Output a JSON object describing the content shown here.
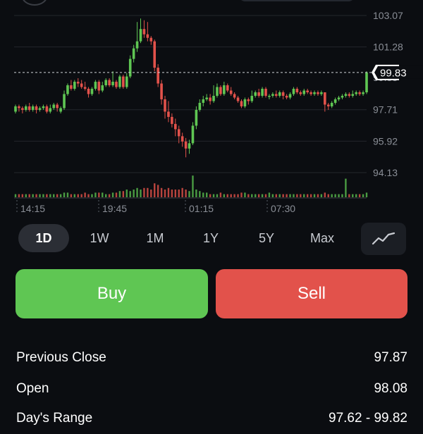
{
  "chart_data": {
    "type": "candlestick",
    "y_ticks": [
      "103.07",
      "101.28",
      "99.83",
      "97.71",
      "95.92",
      "94.13"
    ],
    "current_price": "99.83",
    "x_ticks": [
      "14:15",
      "19:45",
      "01:15",
      "07:30"
    ],
    "ylim": [
      93.0,
      104.0
    ],
    "colors": {
      "up": "#5fc653",
      "down": "#e2524b",
      "volume_up": "#4a9b42",
      "volume_down": "#b8443e"
    },
    "candles": [
      [
        97.6,
        97.9,
        97.5,
        98.0
      ],
      [
        97.9,
        97.8,
        97.6,
        98.0
      ],
      [
        97.8,
        97.7,
        97.5,
        97.9
      ],
      [
        97.7,
        97.9,
        97.6,
        98.0
      ],
      [
        97.9,
        97.7,
        97.6,
        98.1
      ],
      [
        97.7,
        97.9,
        97.6,
        98.0
      ],
      [
        97.9,
        97.7,
        97.5,
        98.0
      ],
      [
        97.7,
        97.8,
        97.6,
        97.9
      ],
      [
        97.8,
        97.9,
        97.7,
        98.0
      ],
      [
        97.9,
        97.6,
        97.5,
        98.0
      ],
      [
        97.6,
        97.8,
        97.5,
        98.0
      ],
      [
        97.8,
        98.0,
        97.7,
        98.1
      ],
      [
        98.0,
        97.8,
        97.6,
        98.1
      ],
      [
        97.6,
        97.8,
        97.5,
        97.9
      ],
      [
        97.8,
        98.6,
        97.7,
        98.8
      ],
      [
        98.6,
        99.1,
        98.5,
        99.2
      ],
      [
        99.1,
        98.9,
        98.8,
        99.4
      ],
      [
        98.9,
        99.3,
        98.8,
        99.4
      ],
      [
        99.3,
        99.2,
        99.0,
        99.5
      ],
      [
        99.2,
        99.0,
        98.9,
        99.4
      ],
      [
        99.0,
        98.9,
        98.8,
        99.3
      ],
      [
        98.9,
        98.6,
        98.4,
        99.0
      ],
      [
        98.6,
        98.9,
        98.5,
        99.0
      ],
      [
        98.9,
        99.3,
        98.8,
        99.4
      ],
      [
        99.3,
        98.8,
        98.6,
        99.4
      ],
      [
        98.8,
        99.1,
        98.7,
        99.3
      ],
      [
        99.1,
        99.4,
        99.0,
        99.5
      ],
      [
        99.4,
        99.1,
        99.0,
        99.5
      ],
      [
        99.1,
        99.3,
        99.0,
        99.9
      ],
      [
        99.3,
        99.0,
        98.9,
        99.4
      ],
      [
        99.0,
        99.6,
        98.9,
        99.7
      ],
      [
        99.6,
        99.0,
        98.9,
        99.7
      ],
      [
        99.0,
        99.6,
        98.9,
        99.8
      ],
      [
        99.6,
        100.6,
        99.5,
        100.8
      ],
      [
        100.6,
        101.2,
        100.4,
        101.4
      ],
      [
        101.2,
        101.6,
        101.0,
        102.7
      ],
      [
        101.6,
        102.3,
        101.5,
        102.9
      ],
      [
        102.3,
        102.0,
        101.8,
        102.8
      ],
      [
        102.0,
        101.8,
        101.6,
        102.7
      ],
      [
        101.8,
        101.6,
        101.4,
        101.9
      ],
      [
        101.6,
        100.1,
        99.9,
        101.7
      ],
      [
        100.1,
        99.2,
        99.0,
        100.3
      ],
      [
        99.2,
        98.3,
        98.0,
        99.4
      ],
      [
        98.3,
        97.6,
        97.2,
        98.5
      ],
      [
        97.6,
        97.3,
        97.0,
        98.2
      ],
      [
        97.3,
        96.9,
        96.7,
        97.5
      ],
      [
        96.9,
        96.6,
        96.2,
        97.2
      ],
      [
        96.6,
        96.2,
        95.8,
        96.8
      ],
      [
        96.2,
        95.9,
        95.6,
        96.4
      ],
      [
        95.9,
        95.5,
        95.0,
        96.1
      ],
      [
        95.5,
        95.8,
        95.2,
        96.0
      ],
      [
        95.8,
        96.8,
        95.7,
        97.0
      ],
      [
        96.8,
        97.7,
        96.6,
        97.9
      ],
      [
        97.7,
        98.1,
        97.6,
        98.3
      ],
      [
        98.1,
        98.3,
        97.9,
        98.5
      ],
      [
        98.3,
        98.4,
        98.2,
        98.6
      ],
      [
        98.4,
        98.2,
        98.0,
        98.6
      ],
      [
        98.2,
        98.5,
        98.1,
        99.1
      ],
      [
        98.5,
        99.0,
        98.4,
        99.2
      ],
      [
        99.0,
        98.6,
        98.5,
        99.1
      ],
      [
        98.6,
        99.1,
        98.5,
        99.3
      ],
      [
        99.1,
        98.8,
        98.7,
        99.2
      ],
      [
        98.8,
        98.6,
        98.5,
        99.0
      ],
      [
        98.6,
        98.4,
        98.3,
        98.7
      ],
      [
        98.4,
        98.2,
        98.1,
        98.5
      ],
      [
        98.2,
        97.9,
        97.8,
        98.3
      ],
      [
        97.9,
        98.3,
        97.8,
        98.4
      ],
      [
        98.3,
        98.2,
        98.0,
        98.4
      ],
      [
        98.2,
        98.5,
        98.1,
        98.8
      ],
      [
        98.5,
        98.7,
        98.4,
        98.8
      ],
      [
        98.7,
        98.5,
        98.4,
        98.9
      ],
      [
        98.5,
        98.9,
        98.4,
        99.0
      ],
      [
        98.9,
        98.5,
        98.4,
        99.0
      ],
      [
        98.5,
        98.5,
        98.3,
        98.6
      ],
      [
        98.5,
        98.6,
        98.4,
        98.7
      ],
      [
        98.6,
        98.5,
        98.4,
        98.8
      ],
      [
        98.5,
        98.7,
        98.4,
        98.8
      ],
      [
        98.7,
        98.5,
        98.3,
        98.8
      ],
      [
        98.5,
        98.4,
        98.3,
        98.6
      ],
      [
        98.4,
        98.6,
        98.3,
        98.7
      ],
      [
        98.6,
        98.9,
        98.5,
        99.0
      ],
      [
        98.9,
        98.7,
        98.6,
        99.0
      ],
      [
        98.7,
        98.6,
        98.5,
        98.8
      ],
      [
        98.6,
        98.8,
        98.5,
        98.9
      ],
      [
        98.8,
        98.7,
        98.6,
        98.9
      ],
      [
        98.7,
        98.6,
        98.5,
        98.8
      ],
      [
        98.6,
        98.7,
        98.5,
        98.8
      ],
      [
        98.7,
        98.6,
        98.5,
        98.8
      ],
      [
        98.6,
        98.7,
        98.5,
        98.8
      ],
      [
        98.7,
        98.0,
        97.6,
        98.7
      ],
      [
        98.0,
        97.9,
        97.7,
        98.1
      ],
      [
        97.9,
        98.1,
        97.8,
        98.2
      ],
      [
        98.1,
        98.3,
        98.0,
        98.4
      ],
      [
        98.3,
        98.4,
        98.2,
        98.5
      ],
      [
        98.4,
        98.5,
        98.3,
        98.6
      ],
      [
        98.5,
        98.6,
        98.4,
        98.7
      ],
      [
        98.6,
        98.5,
        98.4,
        98.7
      ],
      [
        98.5,
        98.6,
        98.4,
        98.8
      ],
      [
        98.6,
        98.7,
        98.5,
        98.8
      ],
      [
        98.7,
        98.6,
        98.5,
        98.8
      ],
      [
        98.6,
        98.7,
        98.5,
        98.8
      ],
      [
        98.7,
        99.83,
        98.6,
        99.9
      ]
    ],
    "volumes": [
      2,
      2,
      2,
      2,
      2,
      2,
      2,
      2,
      2,
      2,
      2,
      2,
      2,
      2,
      3,
      3,
      2,
      2,
      2,
      2,
      3,
      2,
      2,
      3,
      3,
      3,
      2,
      2,
      3,
      3,
      4,
      4,
      5,
      4,
      5,
      6,
      5,
      6,
      6,
      5,
      9,
      8,
      6,
      5,
      6,
      5,
      5,
      5,
      6,
      5,
      4,
      14,
      5,
      4,
      3,
      3,
      2,
      2,
      2,
      3,
      2,
      2,
      2,
      2,
      2,
      3,
      3,
      2,
      2,
      2,
      2,
      2,
      2,
      3,
      2,
      2,
      2,
      2,
      2,
      2,
      2,
      2,
      2,
      2,
      2,
      2,
      2,
      2,
      2,
      3,
      2,
      2,
      2,
      2,
      2,
      12,
      2,
      2,
      2,
      2,
      2,
      3
    ]
  },
  "ranges": {
    "items": [
      "1D",
      "1W",
      "1M",
      "1Y",
      "5Y",
      "Max"
    ],
    "active": "1D",
    "chart_type_icon": "line-chart-icon"
  },
  "actions": {
    "buy_label": "Buy",
    "sell_label": "Sell"
  },
  "stats": [
    {
      "label": "Previous Close",
      "value": "97.87"
    },
    {
      "label": "Open",
      "value": "98.08"
    },
    {
      "label": "Day's Range",
      "value": "97.62 - 99.82"
    }
  ]
}
